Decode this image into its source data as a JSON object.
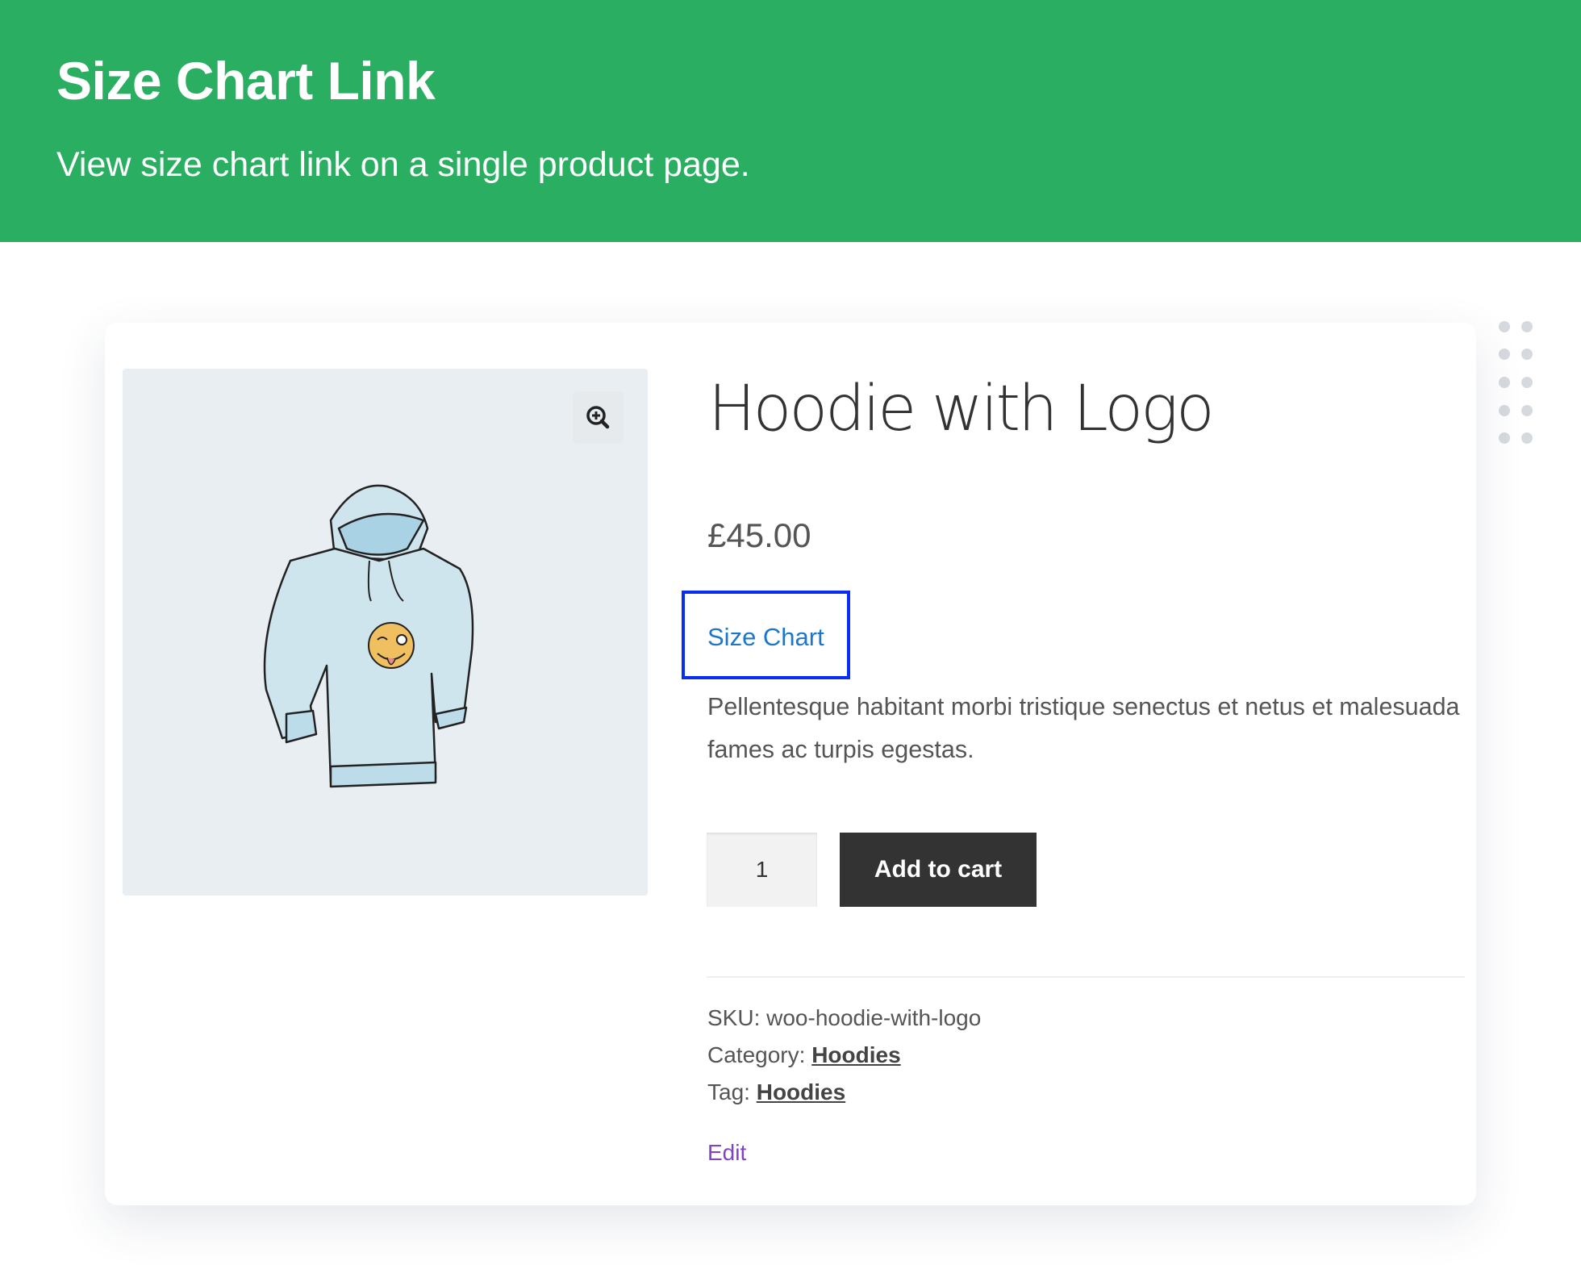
{
  "header": {
    "title": "Size Chart Link",
    "subtitle": "View size chart link on a single product page."
  },
  "product": {
    "title": "Hoodie with Logo",
    "price": "£45.00",
    "size_chart_label": "Size Chart",
    "description": "Pellentesque habitant morbi tristique senectus et netus et malesuada fames ac turpis egestas.",
    "quantity": "1",
    "add_to_cart_label": "Add to cart",
    "sku_label": "SKU:",
    "sku": "woo-hoodie-with-logo",
    "category_label": "Category:",
    "category": "Hoodies",
    "tag_label": "Tag:",
    "tag": "Hoodies",
    "edit_label": "Edit"
  },
  "icons": {
    "zoom": "zoom-in-icon",
    "decor": "dot-grid-icon"
  },
  "colors": {
    "header_bg": "#2aaf62",
    "highlight_box": "#0a2df2",
    "link": "#1b78c9",
    "edit_link": "#8043c4"
  }
}
